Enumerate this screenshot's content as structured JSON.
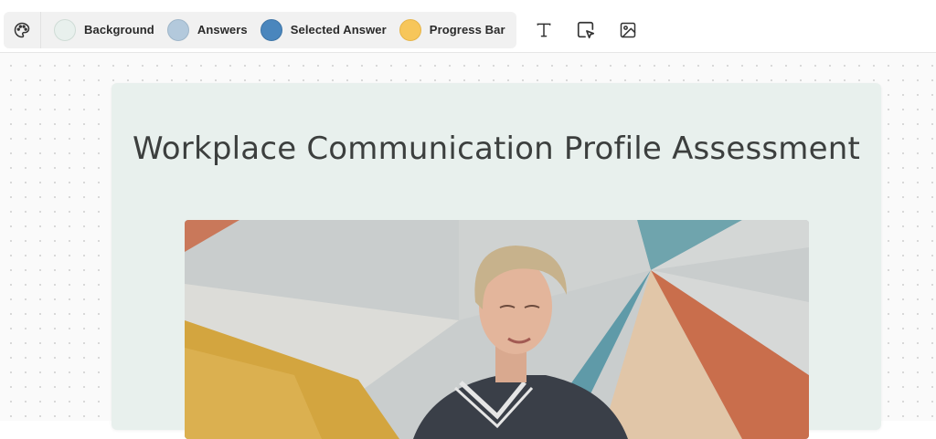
{
  "toolbar": {
    "palette_icon": "palette-icon",
    "swatches": [
      {
        "label": "Background",
        "color": "#e8f0ed",
        "border": "#cfdcd6"
      },
      {
        "label": "Answers",
        "color": "#b3c9dc",
        "border": "#9fb6c9"
      },
      {
        "label": "Selected Answer",
        "color": "#4a86bd",
        "border": "#3d74a6"
      },
      {
        "label": "Progress Bar",
        "color": "#f7c65a",
        "border": "#e6b448"
      }
    ],
    "tools": [
      {
        "icon": "text-icon"
      },
      {
        "icon": "cursor-select-icon"
      },
      {
        "icon": "image-icon"
      }
    ]
  },
  "quiz": {
    "title": "Workplace Communication Profile Assessment",
    "background_color": "#e8f0ed",
    "cover_image": "smiling-woman-portrait-geometric-background"
  }
}
